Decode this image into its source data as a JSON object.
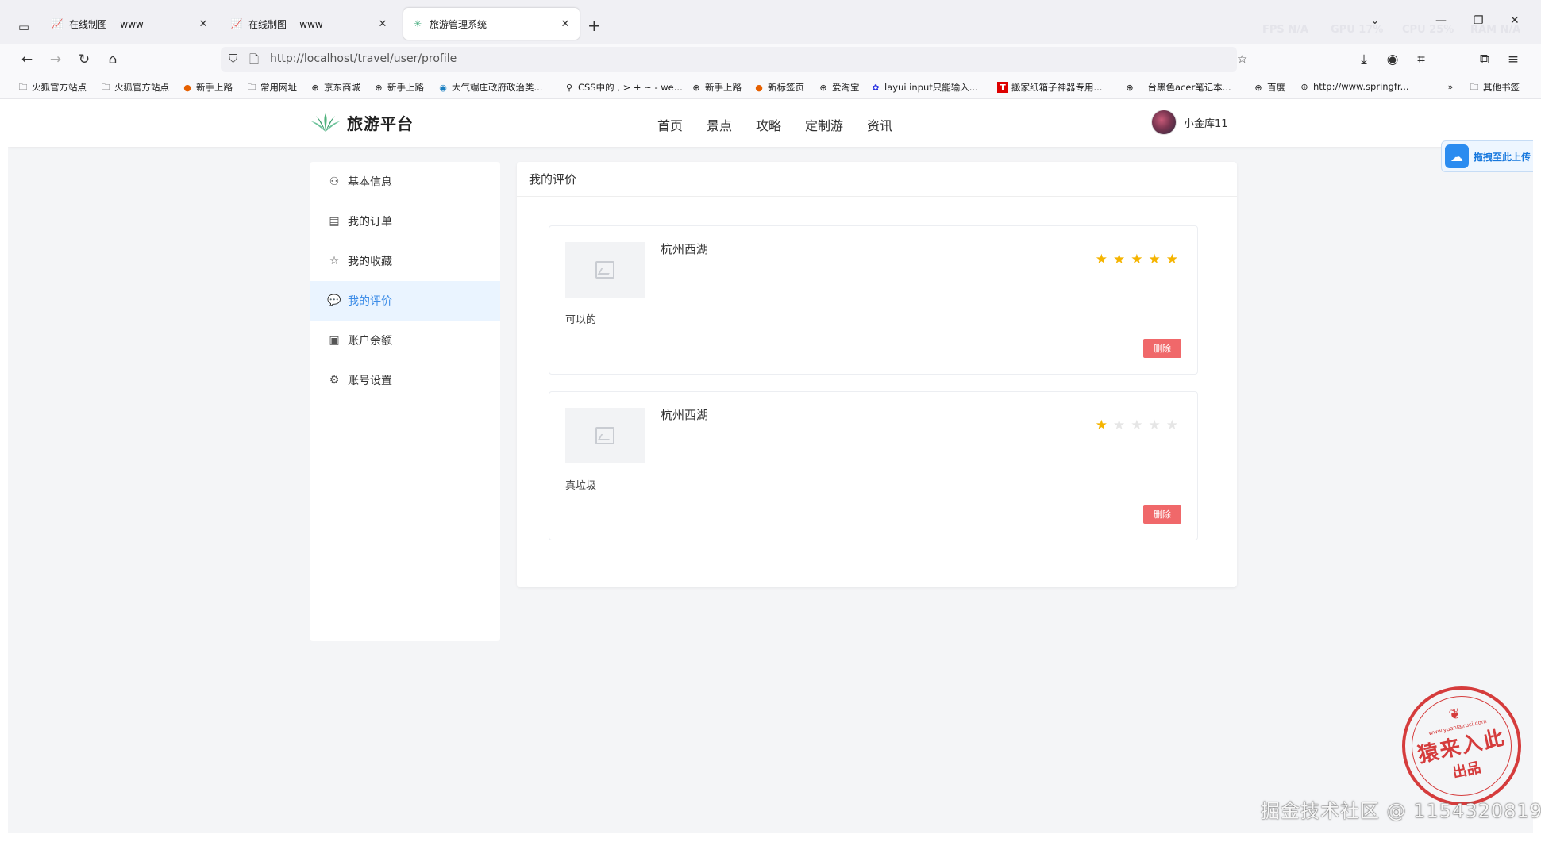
{
  "browser": {
    "tabs": [
      {
        "title": "在线制图- - www",
        "active": false
      },
      {
        "title": "在线制图- - www",
        "active": false
      },
      {
        "title": "旅游管理系统",
        "active": true
      }
    ],
    "url": "http://localhost/travel/user/profile",
    "perf": {
      "fps": "FPS N/A",
      "gpu": "GPU 17%",
      "cpu": "CPU 25%",
      "ram": "RAM N/A"
    },
    "bookmarks": [
      "火狐官方站点",
      "火狐官方站点",
      "新手上路",
      "常用网址",
      "京东商城",
      "新手上路",
      "大气端庄政府政治类...",
      "CSS中的 , > + ~ - we...",
      "新手上路",
      "新标签页",
      "爱淘宝",
      "layui input只能输入...",
      "搬家纸箱子神器专用...",
      "一台黑色acer笔记本...",
      "百度",
      "http://www.springfr...",
      "其他书签"
    ]
  },
  "site": {
    "logo": "旅游平台",
    "menu": [
      "首页",
      "景点",
      "攻略",
      "定制游",
      "资讯"
    ],
    "user_name": "小金库11",
    "upload_label": "拖拽至此上传"
  },
  "sidebar": {
    "items": [
      {
        "label": "基本信息",
        "icon": "user-icon"
      },
      {
        "label": "我的订单",
        "icon": "order-icon"
      },
      {
        "label": "我的收藏",
        "icon": "star-icon"
      },
      {
        "label": "我的评价",
        "icon": "comment-icon",
        "active": true
      },
      {
        "label": "账户余额",
        "icon": "wallet-icon"
      },
      {
        "label": "账号设置",
        "icon": "gear-icon"
      }
    ]
  },
  "panel": {
    "title": "我的评价",
    "reviews": [
      {
        "spot": "杭州西湖",
        "rating": 5,
        "max": 5,
        "comment": "可以的",
        "delete_label": "删除"
      },
      {
        "spot": "杭州西湖",
        "rating": 1,
        "max": 5,
        "comment": "真垃圾",
        "delete_label": "删除"
      }
    ]
  },
  "colors": {
    "accent": "#3c8ce7",
    "star_on": "#f5b400",
    "star_off": "#e6e6e6",
    "danger": "#f0686a"
  },
  "stamp": {
    "main": "猿来入此",
    "sub": "出品",
    "url": "www.yuanlairuci.com"
  },
  "watermark": "掘金技术社区 @ 1154320819"
}
